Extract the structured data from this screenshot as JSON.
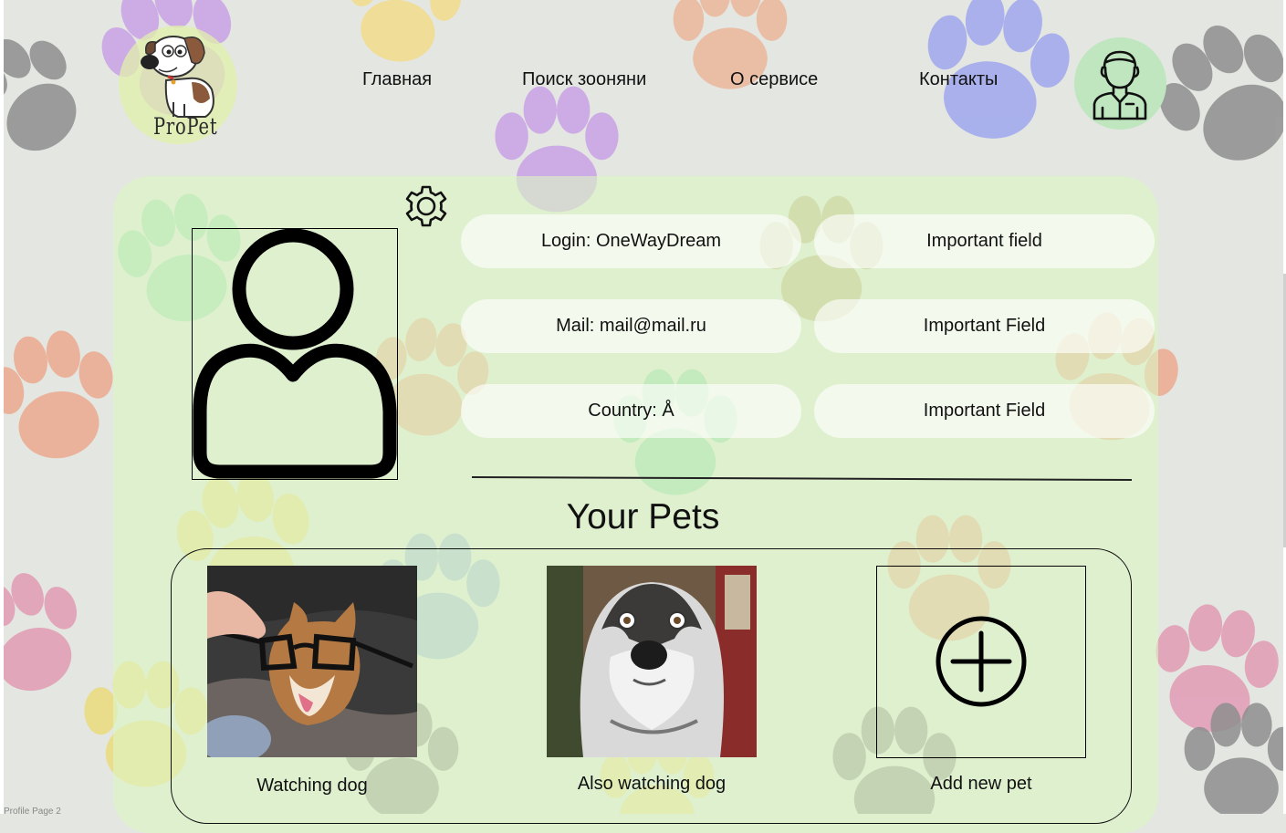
{
  "brand": {
    "logo_text": "ProPet"
  },
  "nav": {
    "items": [
      {
        "label": "Главная"
      },
      {
        "label": "Поиск зооняни"
      },
      {
        "label": "О сервисе"
      },
      {
        "label": "Контакты"
      }
    ]
  },
  "profile": {
    "fields": [
      {
        "text": "Login: OneWayDream"
      },
      {
        "text": "Important field"
      },
      {
        "text": "Mail: mail@mail.ru"
      },
      {
        "text": "Important Field"
      },
      {
        "text": "Country: Å"
      },
      {
        "text": "Important Field"
      }
    ]
  },
  "pets": {
    "title": "Your Pets",
    "items": [
      {
        "caption": "Watching dog"
      },
      {
        "caption": "Also watching dog"
      }
    ],
    "add_label": "Add new pet"
  },
  "footer": {
    "page_label": "Profile Page 2"
  },
  "colors": {
    "background": "#e4e6e1",
    "panel": "#dcf5c4",
    "avatar_bg": "#bfe6bf",
    "field_bg": "#ffffff"
  }
}
